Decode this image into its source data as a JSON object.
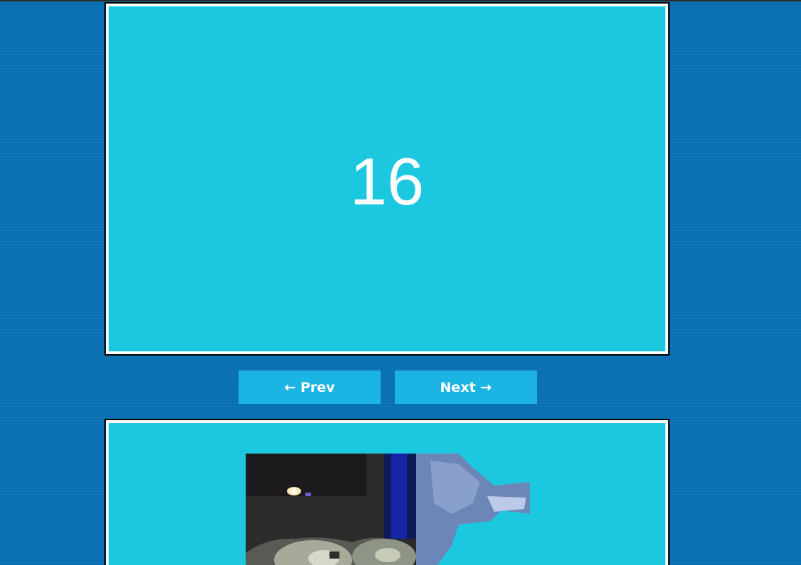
{
  "slide": {
    "number": "16"
  },
  "nav": {
    "prev_label": "← Prev",
    "next_label": "Next →"
  },
  "media": {
    "icon": "photo-image"
  },
  "colors": {
    "background": "#0b72b6",
    "panel": "#1cc8e0",
    "button": "#1cb4e3",
    "text": "#ffffff"
  }
}
